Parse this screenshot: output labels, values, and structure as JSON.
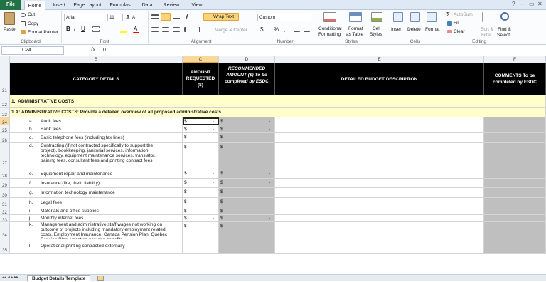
{
  "tabs": [
    "File",
    "Home",
    "Insert",
    "Page Layout",
    "Formulas",
    "Data",
    "Review",
    "View"
  ],
  "window": {
    "help": "?",
    "min": "–",
    "restore": "▭",
    "close": "✕"
  },
  "clipboard": {
    "paste": "Paste",
    "cut": "Cut",
    "copy": "Copy",
    "format_painter": "Format Painter",
    "group": "Clipboard"
  },
  "font": {
    "name": "Arial",
    "size": "11",
    "grow": "A",
    "shrink": "A",
    "bold": "B",
    "italic": "I",
    "underline": "U",
    "font_color": "A",
    "group": "Font"
  },
  "alignment": {
    "wrap": "Wrap Text",
    "merge": "Merge & Center",
    "group": "Alignment"
  },
  "number": {
    "format": "Custom",
    "currency": "$",
    "percent": "%",
    "comma": ",",
    "group": "Number"
  },
  "styles": {
    "conditional": "Conditional",
    "conditional2": "Formatting",
    "format_table": "Format",
    "format_table2": "as Table",
    "cell_styles": "Cell",
    "cell_styles2": "Styles",
    "group": "Styles"
  },
  "cells": {
    "insert": "Insert",
    "delete": "Delete",
    "format": "Format",
    "group": "Cells"
  },
  "editing": {
    "autosum": "AutoSum",
    "fill": "Fill",
    "clear": "Clear",
    "sort": "Sort &",
    "sort2": "Filter",
    "find": "Find &",
    "find2": "Select",
    "group": "Editing"
  },
  "formula_bar": {
    "name_box": "C24",
    "fx": "fx",
    "value": "0"
  },
  "columns": [
    "B",
    "C",
    "D",
    "E",
    "F"
  ],
  "header_row": {
    "row": "21",
    "category": "CATEGORY DETAILS",
    "amount": "AMOUNT REQUESTED ($)",
    "recommended": "RECOMMENDED AMOUNT ($) To be completed by ESDC",
    "description": "DETAILED BUDGET DESCRIPTION",
    "comments": "COMMENTS To be completed by ESDC"
  },
  "section_row": {
    "row": "22",
    "text": "1.: ADMINISTRATIVE COSTS"
  },
  "subsection_row": {
    "row": "23",
    "text": "1.A: ADMINISTRATIVE COSTS: Provide a detailed overview of all proposed administrative costs."
  },
  "rows": [
    {
      "row": "24",
      "letter": "a.",
      "label": "Audit fees",
      "c": "$",
      "cv": "-",
      "d": "$",
      "dv": "-"
    },
    {
      "row": "25",
      "letter": "b.",
      "label": "Bank fees",
      "c": "$",
      "cv": "-",
      "d": "$",
      "dv": "-"
    },
    {
      "row": "26",
      "letter": "c.",
      "label": "Basic telephone fees (including fax lines)",
      "c": "$",
      "cv": "-",
      "d": "$",
      "dv": "-"
    },
    {
      "row": "27",
      "letter": "d.",
      "label": "Contracting (if not contracted specifically to support the project), bookkeeping, janitorial services, information technology, equipment maintenance services, translator, training fees, consultant fees and printing contract fees",
      "c": "$",
      "cv": "-",
      "d": "$",
      "dv": "-"
    },
    {
      "row": "28",
      "letter": "e.",
      "label": "Equipment repair and maintenance",
      "c": "$",
      "cv": "-",
      "d": "$",
      "dv": "-"
    },
    {
      "row": "29",
      "letter": "f.",
      "label": "Insurance (fire, theft, liability)",
      "c": "$",
      "cv": "-",
      "d": "$",
      "dv": "-"
    },
    {
      "row": "30",
      "letter": "g.",
      "label": "Information technology maintenance",
      "c": "$",
      "cv": "-",
      "d": "$",
      "dv": "-"
    },
    {
      "row": "31",
      "letter": "h.",
      "label": "Legal fees",
      "c": "$",
      "cv": "-",
      "d": "$",
      "dv": "-"
    },
    {
      "row": "32",
      "letter": "i.",
      "label": "Materials and office supplies",
      "c": "$",
      "cv": "-",
      "d": "$",
      "dv": "-"
    },
    {
      "row": "33",
      "letter": "j.",
      "label": "Monthly internet fees",
      "c": "$",
      "cv": "-",
      "d": "$",
      "dv": "-"
    },
    {
      "row": "34",
      "letter": "k.",
      "label": "Management and administrative staff wages not working on outcome of projects including mandatory employment related costs, Employment Insurance, Canada Pension Plan, Quebec Pension Plan, vacation pay and benefits",
      "c": "$",
      "cv": "-",
      "d": "$",
      "dv": "-"
    },
    {
      "row": "35",
      "letter": "l.",
      "label": "Operational printing contracted externally",
      "c": "",
      "cv": "",
      "d": "",
      "dv": ""
    }
  ],
  "sheet_tab": "Budget Details Template",
  "colors": {
    "file": "#217346",
    "black": "#000000",
    "section": "#ffffcc",
    "grey": "#bfbfbf",
    "selected": "#f9d99a"
  }
}
